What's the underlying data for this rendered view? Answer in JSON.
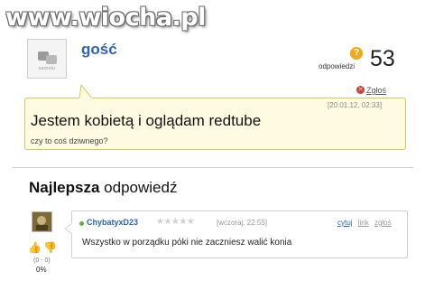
{
  "watermark": "www.wiocha.pl",
  "question": {
    "asker": "gość",
    "avatar_caption": "samolu",
    "answers_label": "odpowiedzi",
    "answers_count": "53",
    "report_label": "Zgłoś",
    "date": "[20.01.12, 02:33]",
    "title": "Jestem kobietą i oglądam redtube",
    "subtitle": "czy to coś dziwnego?"
  },
  "best_answer": {
    "heading_bold": "Najlepsza",
    "heading_rest": "odpowiedź",
    "author": "ChybatyxD23",
    "stars": "★★★★★",
    "rating_stars": 0,
    "date": "[wczoraj, 22:55]",
    "actions": [
      "cytuj",
      "link",
      "zgłoś"
    ],
    "text": "Wszystko w porządku póki nie zaczniesz walić konia",
    "votes": "(0 - 0)",
    "percent": "0%"
  },
  "colors": {
    "link_blue": "#2a64b4",
    "bubble_bg": "#fefbe2",
    "bubble_border": "#d9c65a",
    "badge_orange": "#f2a81d",
    "report_red": "#d23b2f",
    "online_green": "#67ac3c",
    "action_blue": "#2a64b4",
    "action_grey": "#9a9a9a"
  },
  "icons": {
    "answers": "question-badge-icon",
    "report": "report-icon",
    "thumb_up": "thumb-up-icon",
    "thumb_down": "thumb-down-icon",
    "online": "online-dot-icon"
  }
}
